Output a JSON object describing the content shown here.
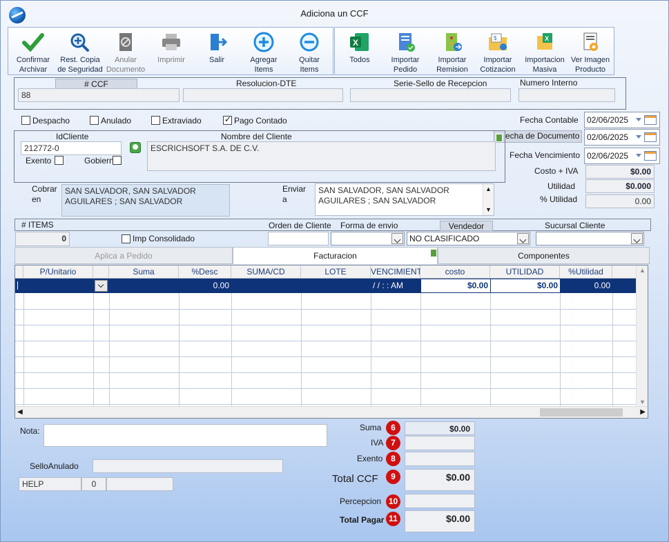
{
  "window": {
    "title": "Adiciona un CCF"
  },
  "toolbar": {
    "confirm": "Confirmar\nArchivar",
    "restore": "Rest. Copia\nde Seguridad",
    "void": "Anular\nDocumento",
    "print": "Imprimir",
    "exit": "Salir",
    "add": "Agregar\nItems",
    "remove": "Quitar\nItems",
    "all": "Todos",
    "import_order": "Importar\nPedido",
    "import_remission": "Importar\nRemision",
    "import_quote": "Importar\nCotizacion",
    "mass_import": "Importacion\nMasiva",
    "view_image": "Ver Imagen\nProducto"
  },
  "header": {
    "ccf_label": "# CCF",
    "ccf_value": "88",
    "resolucion_label": "Resolucion-DTE",
    "resolucion_value": "",
    "serie_label": "Serie-Sello de Recepcion",
    "serie_value": "",
    "numero_label": "Numero Interno",
    "numero_value": ""
  },
  "flags": {
    "despacho": "Despacho",
    "anulado": "Anulado",
    "extraviado": "Extraviado",
    "pago_contado": "Pago Contado"
  },
  "dates": {
    "contable_label": "Fecha Contable",
    "contable_value": "02/06/2025",
    "documento_label": "echa de  Documento",
    "documento_value": "02/06/2025",
    "vencimiento_label": "Fecha Vencimiento",
    "vencimiento_value": "02/06/2025"
  },
  "client": {
    "id_label": "IdCliente",
    "id_value": "212772-0",
    "name_label": "Nombre del Cliente",
    "name_value": "ESCRICHSOFT S.A. DE C.V.",
    "exento_label": "Exento",
    "gobierno_label": "Gobierno",
    "cobrar_label": "Cobrar\nen",
    "cobrar_value": "SAN SALVADOR, SAN SALVADOR\nAGUILARES ; SAN SALVADOR",
    "enviar_label": "Enviar\na",
    "enviar_value": "SAN SALVADOR, SAN SALVADOR\nAGUILARES ; SAN SALVADOR"
  },
  "summary": {
    "costo_iva_label": "Costo + IVA",
    "costo_iva_value": "$0.00",
    "utilidad_label": "Utilidad",
    "utilidad_value": "$0.000",
    "pct_utilidad_label": "% Utilidad",
    "pct_utilidad_value": "0.00"
  },
  "items_bar": {
    "items_label": "# ITEMS",
    "items_value": "0",
    "consolidado_label": "Imp Consolidado",
    "orden_label": "Orden de Cliente",
    "forma_label": "Forma de envio",
    "vendedor_label": "Vendedor",
    "vendedor_value": "NO CLASIFICADO",
    "sucursal_label": "Sucursal Cliente"
  },
  "tabs": {
    "aplica": "Aplica a Pedido",
    "facturacion": "Facturacion",
    "componentes": "Componentes"
  },
  "grid": {
    "columns": [
      "P/Unitario",
      "",
      "Suma",
      "%Desc",
      "SUMA/CD",
      "LOTE",
      "VENCIMIENT",
      "costo",
      "UTILIDAD",
      "%Utilidad"
    ],
    "row": {
      "desc": "0.00",
      "venc": "/  /      :  :  AM",
      "costo": "$0.00",
      "utilidad": "$0.00",
      "pct": "0.00"
    }
  },
  "bottom": {
    "nota_label": "Nota:",
    "sello_label": "SelloAnulado",
    "help_label": "HELP",
    "help_count": "0",
    "suma_label": "Suma",
    "suma_value": "$0.00",
    "iva_label": "IVA",
    "exento_label": "Exento",
    "total_ccf_label": "Total CCF",
    "total_ccf_value": "$0.00",
    "percepcion_label": "Percepcion",
    "total_pagar_label": "Total Pagar",
    "total_pagar_value": "$0.00",
    "badges": [
      "6",
      "7",
      "8",
      "9",
      "10",
      "11"
    ]
  }
}
